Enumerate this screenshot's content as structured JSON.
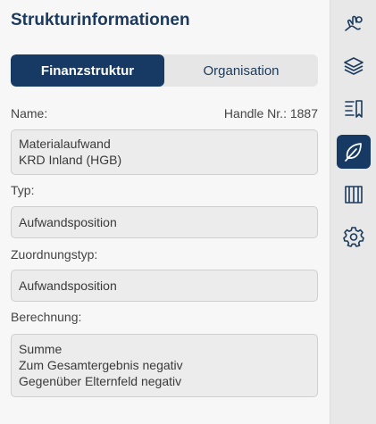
{
  "panel": {
    "title": "Strukturinformationen",
    "tabs": [
      {
        "label": "Finanzstruktur",
        "active": true
      },
      {
        "label": "Organisation",
        "active": false
      }
    ]
  },
  "fields": {
    "name_label": "Name:",
    "handle_text": "Handle Nr.: 1887",
    "name_lines": [
      "Materialaufwand",
      "KRD Inland (HGB)"
    ],
    "typ_label": "Typ:",
    "typ_value": "Aufwandsposition",
    "zuordnung_label": "Zuordnungstyp:",
    "zuordnung_value": "Aufwandsposition",
    "berechnung_label": "Berechnung:",
    "berechnung_lines": [
      "Summe",
      "Zum Gesamtergebnis negativ",
      "Gegenüber Elternfeld negativ"
    ]
  },
  "sidebar": {
    "icons": [
      {
        "name": "hand-coins-icon",
        "active": false
      },
      {
        "name": "layers-icon",
        "active": false
      },
      {
        "name": "list-bookmark-icon",
        "active": false
      },
      {
        "name": "leaf-icon",
        "active": true
      },
      {
        "name": "book-pages-icon",
        "active": false
      },
      {
        "name": "gear-icon",
        "active": false
      }
    ]
  },
  "colors": {
    "accent": "#163a63",
    "title": "#1b3a5c",
    "panel_bg": "#f7f7f7",
    "rail_bg": "#e8e8e8",
    "field_bg": "#ececec"
  }
}
